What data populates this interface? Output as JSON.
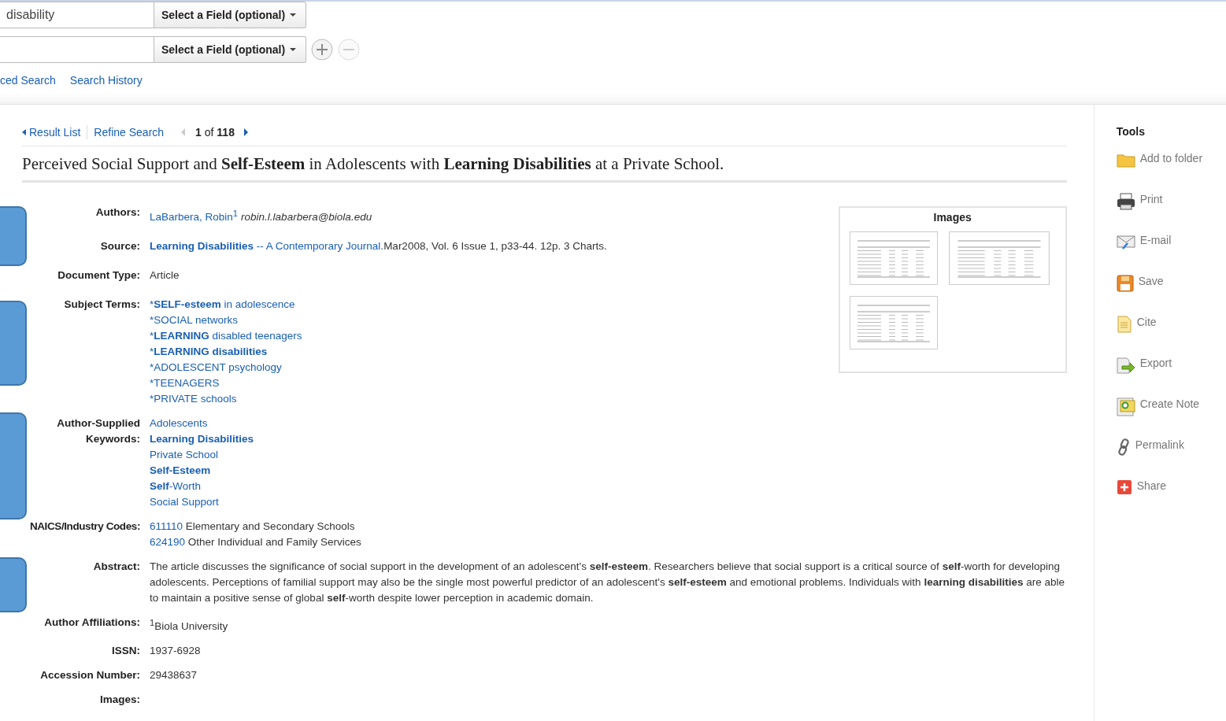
{
  "search": {
    "rows": [
      {
        "value": "disability",
        "field": "Select a Field (optional)"
      },
      {
        "field": "Select a Field (optional)"
      }
    ],
    "links": [
      "ced Search",
      "Search History"
    ]
  },
  "nav": {
    "result_list": "Result List",
    "refine_search": "Refine Search",
    "position": "**1** of **118**"
  },
  "title": "Perceived Social Support and **Self-Esteem** in Adolescents with **Learning Disabilities** at a Private School.",
  "record": [
    {
      "label": "Authors:",
      "kind": "author",
      "name": "LaBarbera, Robin$^{1}$",
      "email": "robin.l.labarbera@biola.edu"
    },
    {
      "label": "Source:",
      "kind": "source",
      "link": "**Learning Disabilities** -- A Contemporary Journal.",
      "text": "Mar2008, Vol. 6 Issue 1, p33-44. 12p. 3 Charts."
    },
    {
      "label": "Document Type:",
      "kind": "text",
      "value": "Article"
    },
    {
      "label": "Subject Terms:",
      "kind": "links",
      "items": [
        {
          "prefix": "*",
          "term": "**SELF-esteem** in adolescence"
        },
        {
          "prefix": "*",
          "term": "SOCIAL networks"
        },
        {
          "prefix": "*",
          "term": "**LEARNING** disabled teenagers"
        },
        {
          "prefix": "*",
          "term": "**LEARNING disabilities**"
        },
        {
          "prefix": "*",
          "term": "ADOLESCENT psychology"
        },
        {
          "prefix": "*",
          "term": "TEENAGERS"
        },
        {
          "prefix": "*",
          "term": "PRIVATE schools"
        }
      ]
    },
    {
      "label": "Author-Supplied Keywords:",
      "kind": "links",
      "items": [
        {
          "term": "Adolescents"
        },
        {
          "term": "**Learning Disabilities**"
        },
        {
          "term": "Private School"
        },
        {
          "term": "**Self-Esteem**"
        },
        {
          "term": "**Self**-Worth"
        },
        {
          "term": "Social Support"
        }
      ]
    },
    {
      "label": "NAICS/Industry Codes:",
      "kind": "codes",
      "items": [
        {
          "code": "611110",
          "text": "Elementary and Secondary Schools"
        },
        {
          "code": "624190",
          "text": "Other Individual and Family Services"
        }
      ]
    },
    {
      "label": "Abstract:",
      "kind": "text",
      "value": "The article discusses the significance of social support in the development of an adolescent's **self-esteem**. Researchers believe that social support is a critical source of **self**-worth for developing adolescents. Perceptions of familial support may also be the single most powerful predictor of an adolescent's **self-esteem** and emotional problems. Individuals with **learning disabilities** are able to maintain a positive sense of global **self**-worth despite lower perception in academic domain."
    },
    {
      "label": "Author Affiliations:",
      "kind": "text",
      "value": "$^{1}$Biola University"
    },
    {
      "label": "ISSN:",
      "kind": "text",
      "value": "1937-6928"
    },
    {
      "label": "Accession Number:",
      "kind": "text",
      "value": "29438637"
    },
    {
      "label": "Images:",
      "kind": "text"
    }
  ],
  "images_panel": {
    "title": "Images"
  },
  "tools": {
    "title": "Tools",
    "items": [
      {
        "label": "Add to folder",
        "kind": "folder"
      },
      {
        "label": "Print",
        "kind": "print"
      },
      {
        "label": "E-mail",
        "kind": "email"
      },
      {
        "label": "Save",
        "kind": "save"
      },
      {
        "label": "Cite",
        "kind": "cite"
      },
      {
        "label": "Export",
        "kind": "export"
      },
      {
        "label": "Create Note",
        "kind": "note"
      },
      {
        "label": "Permalink",
        "kind": "link"
      },
      {
        "label": "Share",
        "kind": "share"
      }
    ]
  }
}
